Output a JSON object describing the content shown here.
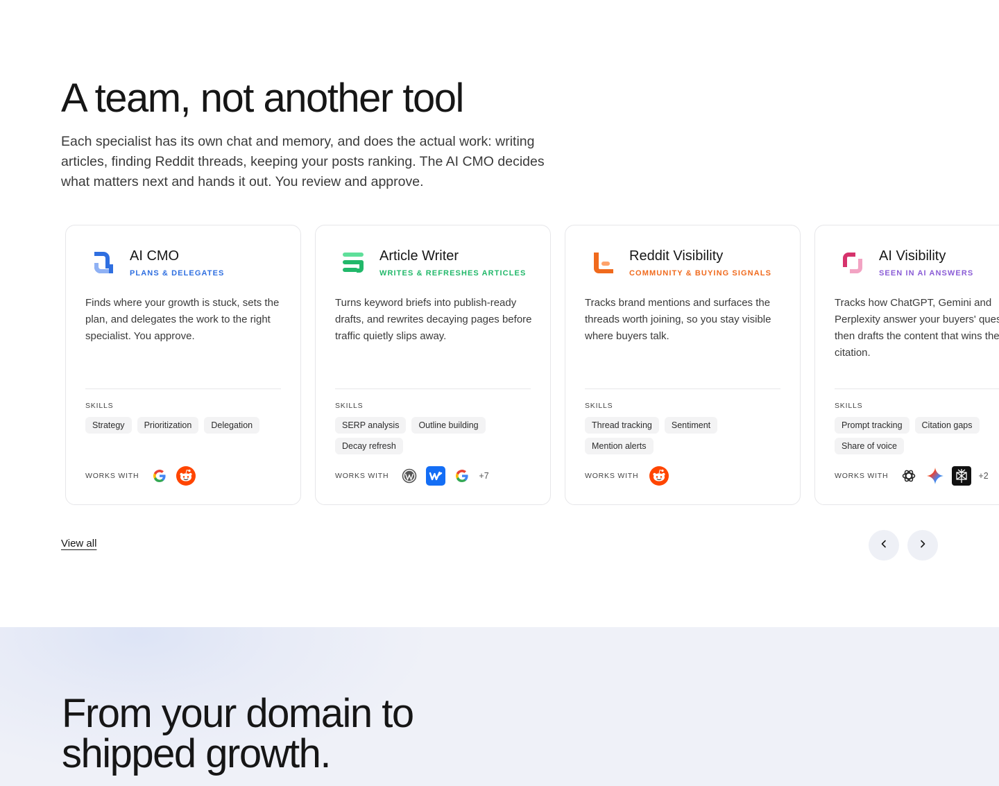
{
  "hero": {
    "title": "A team, not another tool",
    "subtitle": "Each specialist has its own chat and memory, and does the actual work: writing articles, finding Reddit threads, keeping your posts ranking. The AI CMO decides what matters next and hands it out. You review and approve."
  },
  "cards": [
    {
      "name": "AI CMO",
      "tagline": "PLANS & DELEGATES",
      "accent": "#2f6fe0",
      "description": "Finds where your growth is stuck, sets the plan, and delegates the work to the right specialist. You approve.",
      "skills_label": "SKILLS",
      "skills": [
        "Strategy",
        "Prioritization",
        "Delegation"
      ],
      "works_label": "WORKS WITH",
      "integrations": [
        "google-icon",
        "reddit-icon"
      ],
      "more": ""
    },
    {
      "name": "Article Writer",
      "tagline": "WRITES & REFRESHES ARTICLES",
      "accent": "#22b86a",
      "description": "Turns keyword briefs into publish-ready drafts, and rewrites decaying pages before traffic quietly slips away.",
      "skills_label": "SKILLS",
      "skills": [
        "SERP analysis",
        "Outline building",
        "Decay refresh"
      ],
      "works_label": "WORKS WITH",
      "integrations": [
        "wordpress-icon",
        "webflow-icon",
        "google-icon"
      ],
      "more": "+7"
    },
    {
      "name": "Reddit Visibility",
      "tagline": "COMMUNITY & BUYING SIGNALS",
      "accent": "#f06a1d",
      "description": "Tracks brand mentions and surfaces the threads worth joining, so you stay visible where buyers talk.",
      "skills_label": "SKILLS",
      "skills": [
        "Thread tracking",
        "Sentiment",
        "Mention alerts"
      ],
      "works_label": "WORKS WITH",
      "integrations": [
        "reddit-icon"
      ],
      "more": ""
    },
    {
      "name": "AI Visibility",
      "tagline": "SEEN IN AI ANSWERS",
      "accent": "#8a5cd6",
      "description": "Tracks how ChatGPT, Gemini and Perplexity answer your buyers' questions, then drafts the content that wins the citation.",
      "skills_label": "SKILLS",
      "skills": [
        "Prompt tracking",
        "Citation gaps",
        "Share of voice"
      ],
      "works_label": "WORKS WITH",
      "integrations": [
        "chatgpt-icon",
        "gemini-icon",
        "perplexity-icon"
      ],
      "more": "+2"
    }
  ],
  "footer_nav": {
    "view_all": "View all",
    "prev": "previous-arrow-icon",
    "next": "next-arrow-icon"
  },
  "next_section": {
    "title": "From your domain to shipped growth."
  }
}
